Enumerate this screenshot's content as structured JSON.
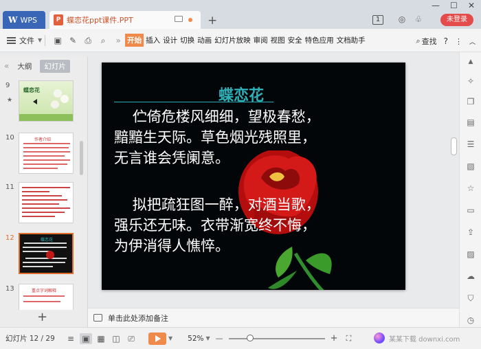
{
  "titlebar": {
    "app_tab": "WPS",
    "doc_tab": "蝶恋花ppt课件.PPT",
    "new_tab": "+",
    "window_count": "1",
    "login": "未登录"
  },
  "ribbon": {
    "file_menu": "文件",
    "tabs": [
      {
        "label": "开始",
        "active": true
      },
      {
        "label": "插入"
      },
      {
        "label": "设计"
      },
      {
        "label": "切换"
      },
      {
        "label": "动画"
      },
      {
        "label": "幻灯片放映"
      },
      {
        "label": "审阅"
      },
      {
        "label": "视图"
      },
      {
        "label": "安全"
      },
      {
        "label": "特色应用"
      },
      {
        "label": "文档助手"
      }
    ],
    "search": "查找",
    "help": "?"
  },
  "left_panel": {
    "tabs": [
      {
        "label": "大纲"
      },
      {
        "label": "幻灯片",
        "active": true
      }
    ],
    "slides": [
      {
        "number": "9",
        "star": "★",
        "title": "蝶恋花",
        "current": false
      },
      {
        "number": "10",
        "star": "",
        "title": "作者介绍",
        "current": false
      },
      {
        "number": "11",
        "star": "",
        "title": "",
        "current": false
      },
      {
        "number": "12",
        "star": "",
        "title": "蝶恋花",
        "current": true
      },
      {
        "number": "13",
        "star": "",
        "title": "重点字词解释",
        "current": false
      }
    ],
    "add_slide": "+"
  },
  "slide": {
    "title": "蝶恋花",
    "stanza1": "    伫倚危楼风细细，望极春愁，\n黯黯生天际。草色烟光残照里，\n无言谁会凭阑意。",
    "stanza2": "    拟把疏狂图一醉，对酒当歌，\n强乐还无味。衣带渐宽终不悔，\n为伊消得人憔悴。"
  },
  "notes": {
    "placeholder": "单击此处添加备注"
  },
  "status": {
    "slide_counter": "幻灯片 12 / 29",
    "zoom": "52%",
    "zoom_out": "—",
    "zoom_in": "+",
    "watermark": "某某下载 downxi.com"
  },
  "colors": {
    "accent": "#f08a4b",
    "wps_blue": "#3a66b8",
    "title_teal": "#2eb0b8",
    "login_red": "#e44b4b"
  }
}
